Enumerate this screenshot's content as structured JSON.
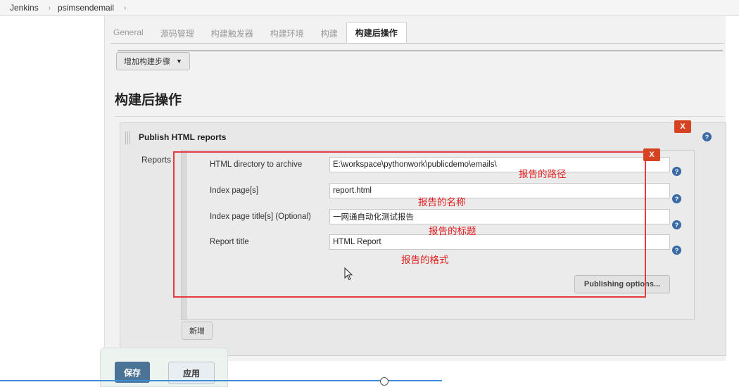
{
  "breadcrumb": {
    "root": "Jenkins",
    "job": "psimsendemail"
  },
  "tabs": [
    "General",
    "源码管理",
    "构建触发器",
    "构建环境",
    "构建",
    "构建后操作"
  ],
  "build": {
    "add_step_label": "增加构建步骤"
  },
  "post_build": {
    "section_title": "构建后操作",
    "publisher_title": "Publish HTML reports",
    "reports_label": "Reports",
    "delete_label": "X",
    "help_symbol": "?",
    "fields": [
      {
        "label": "HTML directory to archive",
        "value": "E:\\workspace\\pythonwork\\publicdemo\\emails\\",
        "annotation": "报告的路径"
      },
      {
        "label": "Index page[s]",
        "value": "report.html",
        "annotation": "报告的名称"
      },
      {
        "label": "Index page title[s] (Optional)",
        "value": "一网通自动化测试报告",
        "annotation": "报告的标题"
      },
      {
        "label": "Report title",
        "value": "HTML Report",
        "annotation": "报告的格式"
      }
    ],
    "publishing_options_label": "Publishing options...",
    "add_label": "新增"
  },
  "footer": {
    "save_label": "保存",
    "apply_label": "应用"
  },
  "colors": {
    "accent": "#4b7395",
    "delete": "#d64322",
    "annotation": "#e02020",
    "highlight_frame": "#e53b3b"
  }
}
